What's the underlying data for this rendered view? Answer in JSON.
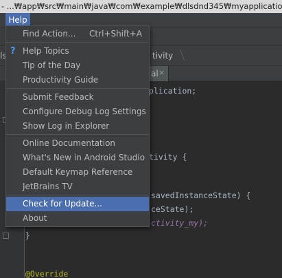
{
  "window": {
    "title": "- ...₩app₩src₩main₩java₩com₩example₩dlsdnd345₩myapplication₩MyAc"
  },
  "menubar": {
    "help_label": "Help"
  },
  "navbar": {
    "left_text": "ls",
    "crumb": "tivity"
  },
  "tabs": {
    "editor_tab_label": "al",
    "close_glyph": "×"
  },
  "help_menu": {
    "groups": [
      [
        {
          "label": "Find Action...",
          "shortcut": "Ctrl+Shift+A",
          "selected": false
        }
      ],
      [
        {
          "label": "Help Topics",
          "icon": "help-question-icon",
          "icon_glyph": "?",
          "selected": false
        },
        {
          "label": "Tip of the Day",
          "selected": false
        },
        {
          "label": "Productivity Guide",
          "selected": false
        }
      ],
      [
        {
          "label": "Submit Feedback",
          "selected": false
        },
        {
          "label": "Configure Debug Log Settings",
          "selected": false
        },
        {
          "label": "Show Log in Explorer",
          "selected": false
        }
      ],
      [
        {
          "label": "Online Documentation",
          "selected": false
        },
        {
          "label": "What's New in Android Studio",
          "selected": false
        },
        {
          "label": "Default Keymap Reference",
          "selected": false
        },
        {
          "label": "JetBrains TV",
          "selected": false
        }
      ],
      [
        {
          "label": "Check for Update...",
          "selected": true
        },
        {
          "label": "About",
          "selected": false
        }
      ]
    ]
  },
  "editor": {
    "lines": [
      {
        "text": "plication;",
        "style": "normal"
      },
      {
        "text": "tivity {",
        "style": "normal"
      },
      {
        "text": "savedInstanceState) {",
        "style": "normal"
      },
      {
        "text": "ceState);",
        "style": "normal"
      },
      {
        "text": "ctivity_my);",
        "style": "italic"
      },
      {
        "text": "}",
        "style": "normal"
      },
      {
        "text": "@Override",
        "style": "annotation"
      }
    ]
  },
  "colors": {
    "accent": "#4b6eaf",
    "menu_bg": "#3c3f41",
    "editor_bg": "#2b2b2b",
    "text": "#bbbbbb",
    "annotation": "#bbb529",
    "field": "#9876aa"
  }
}
